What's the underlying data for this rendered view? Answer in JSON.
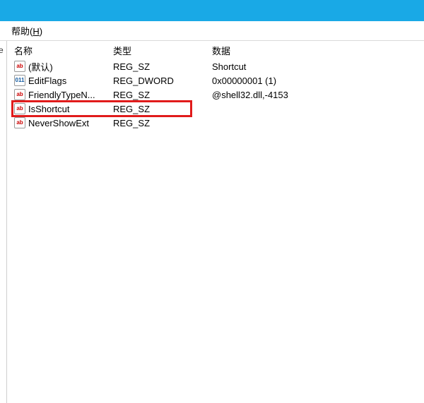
{
  "menu": {
    "help_label": "帮助",
    "help_accel": "H"
  },
  "leftpane": {
    "fragment": "e"
  },
  "columns": {
    "name": "名称",
    "type": "类型",
    "data": "数据"
  },
  "rows": [
    {
      "icon": "sz",
      "name": "(默认)",
      "type": "REG_SZ",
      "data": "Shortcut"
    },
    {
      "icon": "dw",
      "name": "EditFlags",
      "type": "REG_DWORD",
      "data": "0x00000001 (1)"
    },
    {
      "icon": "sz",
      "name": "FriendlyTypeN...",
      "type": "REG_SZ",
      "data": "@shell32.dll,-4153"
    },
    {
      "icon": "sz",
      "name": "IsShortcut",
      "type": "REG_SZ",
      "data": ""
    },
    {
      "icon": "sz",
      "name": "NeverShowExt",
      "type": "REG_SZ",
      "data": ""
    }
  ],
  "highlight": {
    "row_index": 3
  }
}
